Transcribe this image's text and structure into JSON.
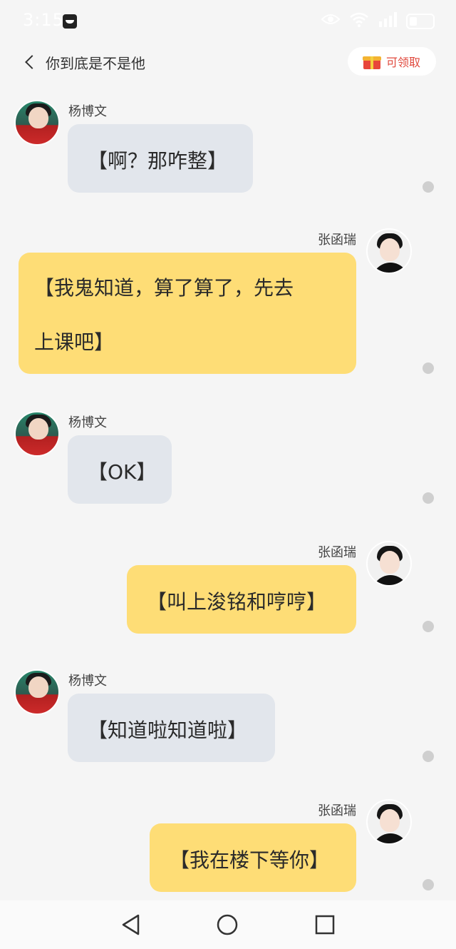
{
  "status_bar": {
    "time": "3:15",
    "icons": [
      "app-icon",
      "eye-icon",
      "wifi-icon",
      "signal-icon",
      "battery-icon"
    ]
  },
  "header": {
    "title": "你到底是不是他",
    "reward_label": "可领取"
  },
  "messages": [
    {
      "side": "left",
      "sender": "杨博文",
      "lines": [
        "【啊？那咋整】"
      ]
    },
    {
      "side": "right",
      "sender": "张函瑞",
      "lines": [
        "【我鬼知道，算了算了，先去",
        "上课吧】"
      ]
    },
    {
      "side": "left",
      "sender": "杨博文",
      "lines": [
        "【OK】"
      ]
    },
    {
      "side": "right",
      "sender": "张函瑞",
      "lines": [
        "【叫上浚铭和哼哼】"
      ]
    },
    {
      "side": "left",
      "sender": "杨博文",
      "lines": [
        "【知道啦知道啦】"
      ]
    },
    {
      "side": "right",
      "sender": "张函瑞",
      "lines": [
        "【我在楼下等你】"
      ]
    }
  ],
  "colors": {
    "background": "#f5f5f5",
    "left_bubble": "#e2e6ec",
    "right_bubble": "#fedd76",
    "reward_text": "#e0493d",
    "status_dot": "#cfcfcf"
  },
  "nav": {
    "icons": [
      "back-triangle-icon",
      "home-circle-icon",
      "recent-square-icon"
    ]
  }
}
